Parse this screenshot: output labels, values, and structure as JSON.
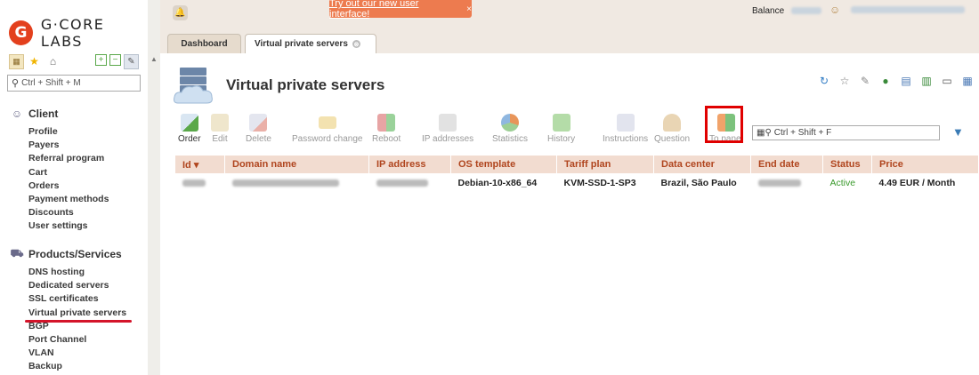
{
  "logo": {
    "mark": "G",
    "text": "G·CORE LABS"
  },
  "sidebar": {
    "search_placeholder": "Ctrl + Shift + M",
    "sections": [
      {
        "title": "Client",
        "icon": "person-icon",
        "items": [
          "Profile",
          "Payers",
          "Referral program",
          "Cart",
          "Orders",
          "Payment methods",
          "Discounts",
          "User settings"
        ]
      },
      {
        "title": "Products/Services",
        "icon": "cart-icon",
        "items": [
          "DNS hosting",
          "Dedicated servers",
          "SSL certificates",
          "Virtual private servers",
          "BGP",
          "Port Channel",
          "VLAN",
          "Backup"
        ]
      }
    ],
    "active_item": "Virtual private servers"
  },
  "topbar": {
    "banner": "Try out our new user interface!",
    "banner_close": "×",
    "balance_label": "Balance"
  },
  "tabs": [
    {
      "label": "Dashboard"
    },
    {
      "label": "Virtual private servers",
      "close": "⊗"
    }
  ],
  "main": {
    "title": "Virtual private servers",
    "toolbar": [
      {
        "label": "Order",
        "enabled": true,
        "color": "#5aa84a"
      },
      {
        "label": "Edit",
        "enabled": false,
        "color": "#d8c79a"
      },
      {
        "label": "Delete",
        "enabled": false,
        "color": "#c9c9d6"
      },
      {
        "label": "Password change",
        "enabled": false,
        "color": "#e6d19a"
      },
      {
        "label": "Reboot",
        "enabled": false,
        "color": "#9ad29a"
      },
      {
        "label": "IP addresses",
        "enabled": false,
        "color": "#cfcfcf"
      },
      {
        "label": "Statistics",
        "enabled": false,
        "color": "#9dcf95"
      },
      {
        "label": "History",
        "enabled": false,
        "color": "#8ccf7b"
      },
      {
        "label": "Instructions",
        "enabled": false,
        "color": "#c9cde0"
      },
      {
        "label": "Question",
        "enabled": false,
        "color": "#d7b98a"
      },
      {
        "label": "To panel",
        "enabled": false,
        "color": "#7cc27c"
      }
    ],
    "table_search_placeholder": "Ctrl + Shift + F",
    "columns": [
      "Id ▾",
      "Domain name",
      "IP address",
      "OS template",
      "Tariff plan",
      "Data center",
      "End date",
      "Status",
      "Price"
    ],
    "rows": [
      {
        "os": "Debian-10-x86_64",
        "tariff": "KVM-SSD-1-SP3",
        "datacenter": "Brazil, São Paulo",
        "status": "Active",
        "price": "4.49 EUR / Month"
      }
    ]
  },
  "colors": {
    "accent": "#e3401d",
    "header_bg": "#f0e9e2",
    "th_bg": "#f2dcd0",
    "th_text": "#b0451e",
    "status_active": "#3a9a2c",
    "highlight": "#e00000"
  }
}
